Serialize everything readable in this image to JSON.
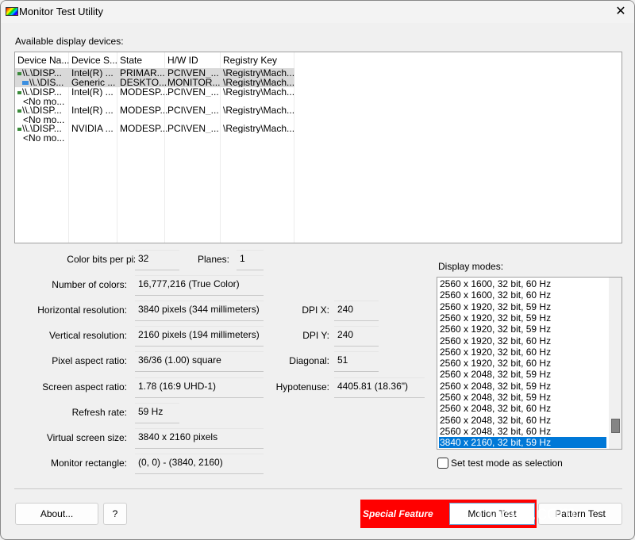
{
  "window": {
    "title": "Monitor Test Utility",
    "close_glyph": "✕"
  },
  "devices": {
    "label": "Available display devices:",
    "columns": [
      "Device Na...",
      "Device S...",
      "State",
      "H/W ID",
      "Registry Key"
    ],
    "rows": [
      {
        "icon": "adapter-icon",
        "name": "\\\\.\\DISP...",
        "string": "Intel(R) ...",
        "state": "PRIMAR...",
        "hwid": "PCI\\VEN_...",
        "reg": "\\Registry\\Mach...",
        "selected": true
      },
      {
        "icon": "monitor-icon",
        "name": "\\\\.\\DIS...",
        "string": "Generic ...",
        "state": "DESKTO...",
        "hwid": "MONITOR...",
        "reg": "\\Registry\\Mach...",
        "selected": true
      },
      {
        "icon": "adapter-icon",
        "name": "\\\\.\\DISP...",
        "string": "Intel(R) ...",
        "state": "MODESP...",
        "hwid": "PCI\\VEN_...",
        "reg": "\\Registry\\Mach...",
        "selected": false
      },
      {
        "icon": "",
        "name": "<No mo...",
        "string": "",
        "state": "",
        "hwid": "",
        "reg": "",
        "selected": false
      },
      {
        "icon": "adapter-icon",
        "name": "\\\\.\\DISP...",
        "string": "Intel(R) ...",
        "state": "MODESP...",
        "hwid": "PCI\\VEN_...",
        "reg": "\\Registry\\Mach...",
        "selected": false
      },
      {
        "icon": "",
        "name": "<No mo...",
        "string": "",
        "state": "",
        "hwid": "",
        "reg": "",
        "selected": false
      },
      {
        "icon": "adapter-icon",
        "name": "\\\\.\\DISP...",
        "string": "NVIDIA ...",
        "state": "MODESP...",
        "hwid": "PCI\\VEN_...",
        "reg": "\\Registry\\Mach...",
        "selected": false
      },
      {
        "icon": "",
        "name": "<No mo...",
        "string": "",
        "state": "",
        "hwid": "",
        "reg": "",
        "selected": false
      }
    ]
  },
  "info": {
    "color_bits_label": "Color bits per pixel:",
    "color_bits": "32",
    "planes_label": "Planes:",
    "planes": "1",
    "num_colors_label": "Number of colors:",
    "num_colors": "16,777,216 (True Color)",
    "hres_label": "Horizontal resolution:",
    "hres": "3840 pixels (344 millimeters)",
    "vres_label": "Vertical resolution:",
    "vres": "2160 pixels (194 millimeters)",
    "pixel_aspect_label": "Pixel aspect ratio:",
    "pixel_aspect": "36/36 (1.00) square",
    "screen_aspect_label": "Screen aspect ratio:",
    "screen_aspect": "1.78 (16:9 UHD-1)",
    "refresh_label": "Refresh rate:",
    "refresh": "59 Hz",
    "virtual_label": "Virtual screen size:",
    "virtual": "3840 x 2160 pixels",
    "monrect_label": "Monitor rectangle:",
    "monrect": "(0, 0) - (3840, 2160)",
    "dpix_label": "DPI X:",
    "dpix": "240",
    "dpiy_label": "DPI Y:",
    "dpiy": "240",
    "diagonal_label": "Diagonal:",
    "diagonal": "51",
    "hypotenuse_label": "Hypotenuse:",
    "hypotenuse": "4405.81 (18.36\")"
  },
  "modes": {
    "label": "Display modes:",
    "items": [
      "2560 x 1600, 32 bit, 60 Hz",
      "2560 x 1600, 32 bit, 60 Hz",
      "2560 x 1920, 32 bit, 59 Hz",
      "2560 x 1920, 32 bit, 59 Hz",
      "2560 x 1920, 32 bit, 59 Hz",
      "2560 x 1920, 32 bit, 60 Hz",
      "2560 x 1920, 32 bit, 60 Hz",
      "2560 x 1920, 32 bit, 60 Hz",
      "2560 x 2048, 32 bit, 59 Hz",
      "2560 x 2048, 32 bit, 59 Hz",
      "2560 x 2048, 32 bit, 59 Hz",
      "2560 x 2048, 32 bit, 60 Hz",
      "2560 x 2048, 32 bit, 60 Hz",
      "2560 x 2048, 32 bit, 60 Hz",
      "3840 x 2160, 32 bit, 59 Hz"
    ],
    "selected_index": 14,
    "checkbox_label": "Set test mode as selection",
    "checkbox_checked": false
  },
  "buttons": {
    "about": "About...",
    "help": "?",
    "special_feature": "Special Feature",
    "motion_test": "Motion Test",
    "pattern_test": "Pattern Test"
  },
  "watermark": "LO4D.com",
  "colors": {
    "accent_selection": "#0078d7",
    "special_feature_bg": "#ff0000"
  }
}
